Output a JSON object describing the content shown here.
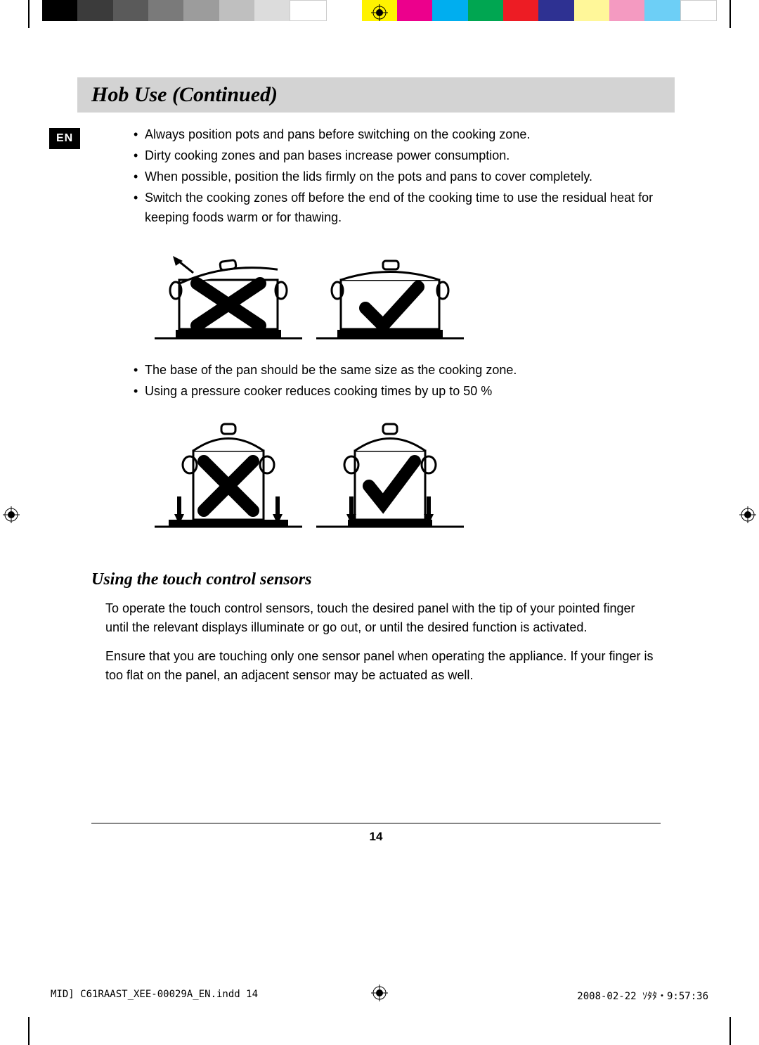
{
  "colorbar": [
    "#000000",
    "#3b3b3b",
    "#5a5a5a",
    "#7a7a7a",
    "#9c9c9c",
    "#bfbfbf",
    "#dcdcdc",
    "#ffffff",
    "",
    "#fff200",
    "#ec008c",
    "#00aeef",
    "#00a651",
    "#ed1c24",
    "#2e3192",
    "#fff799",
    "#f49ac1",
    "#6dcff6",
    "#ffffff"
  ],
  "lang_badge": "EN",
  "title": "Hob Use (Continued)",
  "bullets_top": [
    "Always position pots and pans before switching on the cooking zone.",
    "Dirty cooking zones and pan bases increase power consumption.",
    "When possible, position the lids firmly on the pots and pans to cover completely.",
    "Switch the cooking zones off before the end of the cooking time to use the residual heat for keeping foods warm or for thawing."
  ],
  "bullets_mid": [
    "The base of the pan should be the same size as the cooking zone.",
    "Using a pressure cooker reduces cooking times by up to 50 %"
  ],
  "subhead": "Using the touch control sensors",
  "para1": "To operate the touch control sensors, touch the desired panel with the tip of your pointed finger until the relevant displays illuminate or go out, or until the desired function is activated.",
  "para2": "Ensure that you are touching only one sensor panel when operating the appliance. If your finger is too flat on the panel, an adjacent sensor may be actuated as well.",
  "page_number": "14",
  "footer_file": "MID] C61RAAST_XEE-00029A_EN.indd   14",
  "footer_date": "2008-02-22   ｿﾀﾀ・9:57:36"
}
